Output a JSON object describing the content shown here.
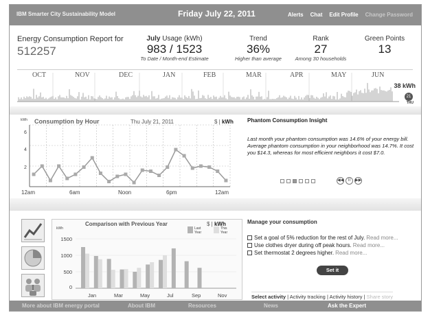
{
  "topbar": {
    "brand": "IBM Smarter City Sustainability Model",
    "date": "Friday July 22, 2011",
    "links": [
      "Alerts",
      "Chat",
      "Edit Profile"
    ],
    "links_dim": "Change Password"
  },
  "report": {
    "title": "Energy Consumption Report for",
    "account_id": "512257",
    "usage": {
      "label_bold": "July",
      "label_rest": " Usage (kWh)",
      "value": "983 / 1523",
      "sub": "To Date / Month-end Estimate"
    },
    "trend": {
      "label": "Trend",
      "value": "36%",
      "sub": "Higher than average"
    },
    "rank": {
      "label": "Rank",
      "value": "27",
      "sub": "Among 30 households"
    },
    "points": {
      "label": "Green Points",
      "value": "13"
    }
  },
  "timeline": {
    "months": [
      "OCT",
      "NOV",
      "DEC",
      "JAN",
      "FEB",
      "MAR",
      "APR",
      "MAY",
      "JUN"
    ],
    "current_value": "38 kWh",
    "current_day": "THU",
    "current_day_num": "21"
  },
  "hourly": {
    "title": "Consumption by Hour",
    "date": "Thu July 21, 2011",
    "unit_left": "$ | ",
    "unit_right": "kWh",
    "y_unit": "kWh",
    "chart_data": {
      "type": "line",
      "title": "Consumption by Hour",
      "ylabel": "kWh",
      "ylim": [
        0,
        6
      ],
      "yticks": [
        "6",
        "4",
        "2"
      ],
      "xticks": [
        "12am",
        "6am",
        "Noon",
        "6pm",
        "12am"
      ],
      "values": [
        1.2,
        2.0,
        0.6,
        2.0,
        0.8,
        1.2,
        1.9,
        2.8,
        1.3,
        0.5,
        1.0,
        1.2,
        0.4,
        1.6,
        1.5,
        1.1,
        1.9,
        3.6,
        3.0,
        1.8,
        2.0,
        1.9,
        1.5,
        0.6
      ]
    }
  },
  "phantom": {
    "title": "Phantom Consumption Insight",
    "text": "Last month your phantom consumption was 14.6% of your energy bill. Average phantom consumption in your neighborhood was 14.7%. It cost you $14.3, whereas for most efficient neighbors it cost $7.0.",
    "pages": 6,
    "active_page": 2,
    "controls": [
      "◀◀",
      "II",
      "▶▶"
    ]
  },
  "comparison": {
    "title": "Comparison with Previous Year",
    "unit_left": "$ | ",
    "unit_right": "kWh",
    "y_unit": "kWh",
    "legend_last": "Last Year",
    "legend_this": "This Year",
    "colors": {
      "last": "#b3b3b3",
      "this": "#dedede"
    },
    "chart_data": {
      "type": "bar",
      "title": "Comparison with Previous Year",
      "ylabel": "kWh",
      "ylim": [
        0,
        1750
      ],
      "yticks": [
        "1500",
        "1000",
        "500",
        "0"
      ],
      "xticks": [
        "Jan",
        "Mar",
        "May",
        "Jul",
        "Sep",
        "Nov"
      ],
      "categories": [
        "Jan",
        "Feb",
        "Mar",
        "Apr",
        "May",
        "Jun",
        "Jul",
        "Aug",
        "Sep",
        "Oct",
        "Nov",
        "Dec"
      ],
      "series": [
        {
          "name": "Last Year",
          "values": [
            1250,
            980,
            890,
            570,
            500,
            720,
            860,
            1210,
            820,
            620,
            null,
            null
          ]
        },
        {
          "name": "This Year",
          "values": [
            1050,
            880,
            560,
            580,
            620,
            790,
            1000,
            null,
            null,
            null,
            null,
            null
          ]
        }
      ]
    }
  },
  "manage": {
    "title": "Manage your consumption",
    "goals": [
      {
        "text": "Set a goal of 5% reduction for the rest of July.",
        "more": "Read more..."
      },
      {
        "text": "Use clothes dryer during off peak hours.",
        "more": "Read more..."
      },
      {
        "text": "Set thermostat 2 degrees higher.",
        "more": "Read more..."
      }
    ],
    "button": "Set it",
    "activity": {
      "selected": "Select activity",
      "tracking": "Activity tracking",
      "history": "Activity history",
      "share": "Share story",
      "sep": "|"
    }
  },
  "footer": {
    "links": [
      "More about IBM energy portal",
      "About IBM",
      "Resources",
      "News",
      "Ask the Expert"
    ]
  }
}
